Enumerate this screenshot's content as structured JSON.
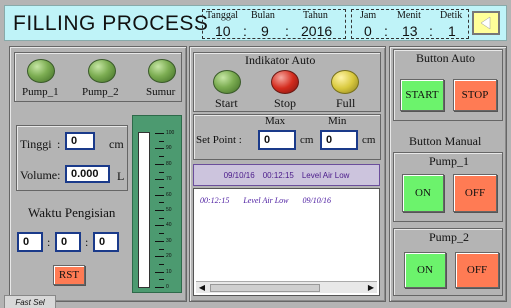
{
  "header": {
    "title": "FILLING PROCESS",
    "datetime": {
      "labels": {
        "tanggal": "Tanggal",
        "bulan": "Bulan",
        "tahun": "Tahun",
        "jam": "Jam",
        "menit": "Menit",
        "detik": "Detik"
      },
      "values": {
        "tanggal": "10",
        "bulan": "9",
        "tahun": "2016",
        "jam": "0",
        "menit": "13",
        "detik": "1"
      },
      "sep": ":"
    },
    "nav_icon": "arrow-left-icon"
  },
  "pumps": [
    {
      "label": "Pump_1",
      "state": "green"
    },
    {
      "label": "Pump_2",
      "state": "green"
    },
    {
      "label": "Sumur",
      "state": "green"
    }
  ],
  "measurements": {
    "tinggi_label": "Tinggi",
    "tinggi_value": "0",
    "tinggi_unit": "cm",
    "volume_label": "Volume:",
    "volume_value": "0.000",
    "volume_unit": "L"
  },
  "timer": {
    "title": "Waktu Pengisian",
    "h": "0",
    "m": "0",
    "s": "0",
    "sep": ":",
    "reset_label": "RST"
  },
  "tank": {
    "scale": [
      "100",
      "90",
      "80",
      "70",
      "60",
      "50",
      "40",
      "30",
      "20",
      "10",
      "0"
    ],
    "level_percent": 0
  },
  "indikator": {
    "title": "Indikator Auto",
    "items": [
      {
        "label": "Start",
        "color": "green"
      },
      {
        "label": "Stop",
        "color": "red"
      },
      {
        "label": "Full",
        "color": "yellow"
      }
    ]
  },
  "setpoint": {
    "label": "Set Point :",
    "max_label": "Max",
    "min_label": "Min",
    "max_value": "0",
    "min_value": "0",
    "unit": "cm"
  },
  "alarm": {
    "banner": {
      "date": "09/10/16",
      "time": "00:12:15",
      "message": "Level Air Low"
    },
    "rows": [
      {
        "time": "00:12:15",
        "message": "Level Air Low",
        "date": "09/10/16"
      }
    ],
    "scroll_left": "◀",
    "scroll_right": "▶"
  },
  "button_auto": {
    "title": "Button Auto",
    "start_label": "START",
    "stop_label": "STOP"
  },
  "button_manual": {
    "title": "Button Manual",
    "pump1_title": "Pump_1",
    "pump2_title": "Pump_2",
    "on_label": "ON",
    "off_label": "OFF"
  },
  "footer": {
    "tab_label": "Fast Sel"
  },
  "colors": {
    "header_bg": "#bff3f8",
    "btn_green": "#6cf36c",
    "btn_red": "#ff7b54",
    "tank": "#4c9a70",
    "alarm_text": "#4a1a8a"
  }
}
